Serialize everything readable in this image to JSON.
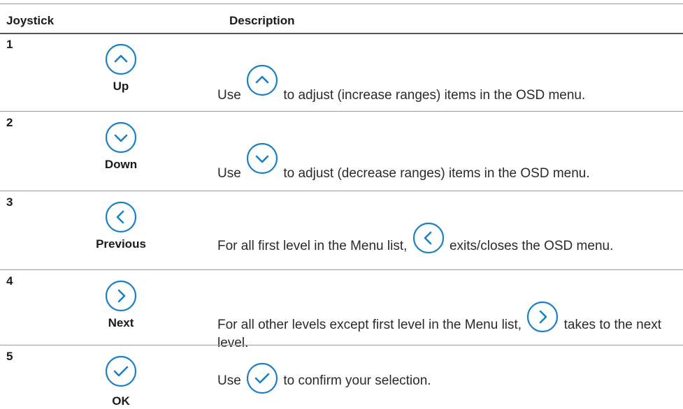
{
  "header": {
    "col_joystick": "Joystick",
    "col_description": "Description"
  },
  "accent_color": "#1a7fc6",
  "rows": [
    {
      "number": "1",
      "icon": "chevron-up-icon",
      "label": "Up",
      "desc_before": "Use",
      "desc_after": "to adjust (increase ranges) items in the OSD menu."
    },
    {
      "number": "2",
      "icon": "chevron-down-icon",
      "label": "Down",
      "desc_before": "Use",
      "desc_after": "to adjust (decrease ranges) items in the OSD menu."
    },
    {
      "number": "3",
      "icon": "chevron-left-icon",
      "label": "Previous",
      "desc_before": "For all first level in the Menu list,",
      "desc_after": "exits/closes the OSD menu."
    },
    {
      "number": "4",
      "icon": "chevron-right-icon",
      "label": "Next",
      "desc_before": "For all other levels except first level in the Menu list,",
      "desc_after": "takes to the next level."
    },
    {
      "number": "5",
      "icon": "checkmark-icon",
      "label": "OK",
      "desc_before": "Use",
      "desc_after": "to confirm your selection."
    }
  ]
}
